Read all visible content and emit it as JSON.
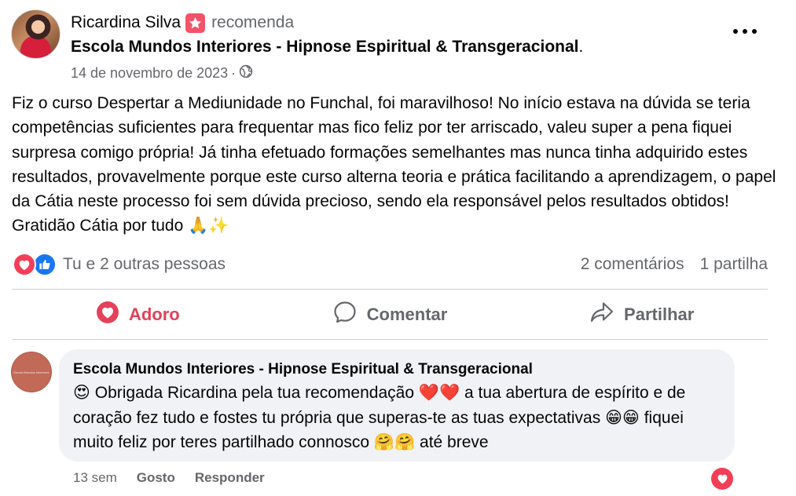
{
  "post": {
    "author": "Ricardina Silva",
    "action_text": "recomenda",
    "page_name": "Escola Mundos Interiores - Hipnose Espiritual & Transgeracional",
    "page_suffix": ".",
    "date": "14 de novembro de 2023",
    "separator": "·",
    "privacy_icon": "globe-icon",
    "text": "Fiz o curso Despertar a Mediunidade no Funchal, foi maravilhoso! No início estava na dúvida se teria competências suficientes para frequentar mas fico feliz por ter arriscado, valeu super a pena fiquei surpresa comigo própria! Já tinha efetuado formações semelhantes mas nunca tinha adquirido estes resultados, provavelmente porque este curso alterna teoria e prática facilitando a aprendizagem, o papel da Cátia neste processo foi sem dúvida precioso, sendo ela responsável pelos resultados obtidos! Gratidão Cátia por tudo",
    "text_emojis": "🙏✨"
  },
  "reactions": {
    "icons": [
      "love-icon",
      "like-icon"
    ],
    "summary": "Tu e 2 outras pessoas",
    "comments": "2 comentários",
    "shares": "1 partilha"
  },
  "actions": {
    "love_label": "Adoro",
    "comment_label": "Comentar",
    "share_label": "Partilhar"
  },
  "comment": {
    "author": "Escola Mundos Interiores - Hipnose Espiritual & Transgeracional",
    "avatar_text": "Escola Mundos Interiores",
    "emoji_start": "😍",
    "part1": "Obrigada Ricardina pela tua recomendação",
    "emoji_hearts": "❤️❤️",
    "part2": "a tua abertura de espírito e de coração fez tudo e fostes tu própria que superas-te as tuas expectativas",
    "emoji_grin": "😁😁",
    "part3": "fiquei muito feliz por teres partilhado connosco",
    "emoji_hug": "🤗🤗",
    "part4": "até breve",
    "time": "13 sem",
    "like_label": "Gosto",
    "reply_label": "Responder",
    "reaction_icon": "love-icon"
  },
  "colors": {
    "love": "#f33e58",
    "like": "#1877f2",
    "secondary_text": "#65676b",
    "bubble": "#f0f2f5"
  }
}
